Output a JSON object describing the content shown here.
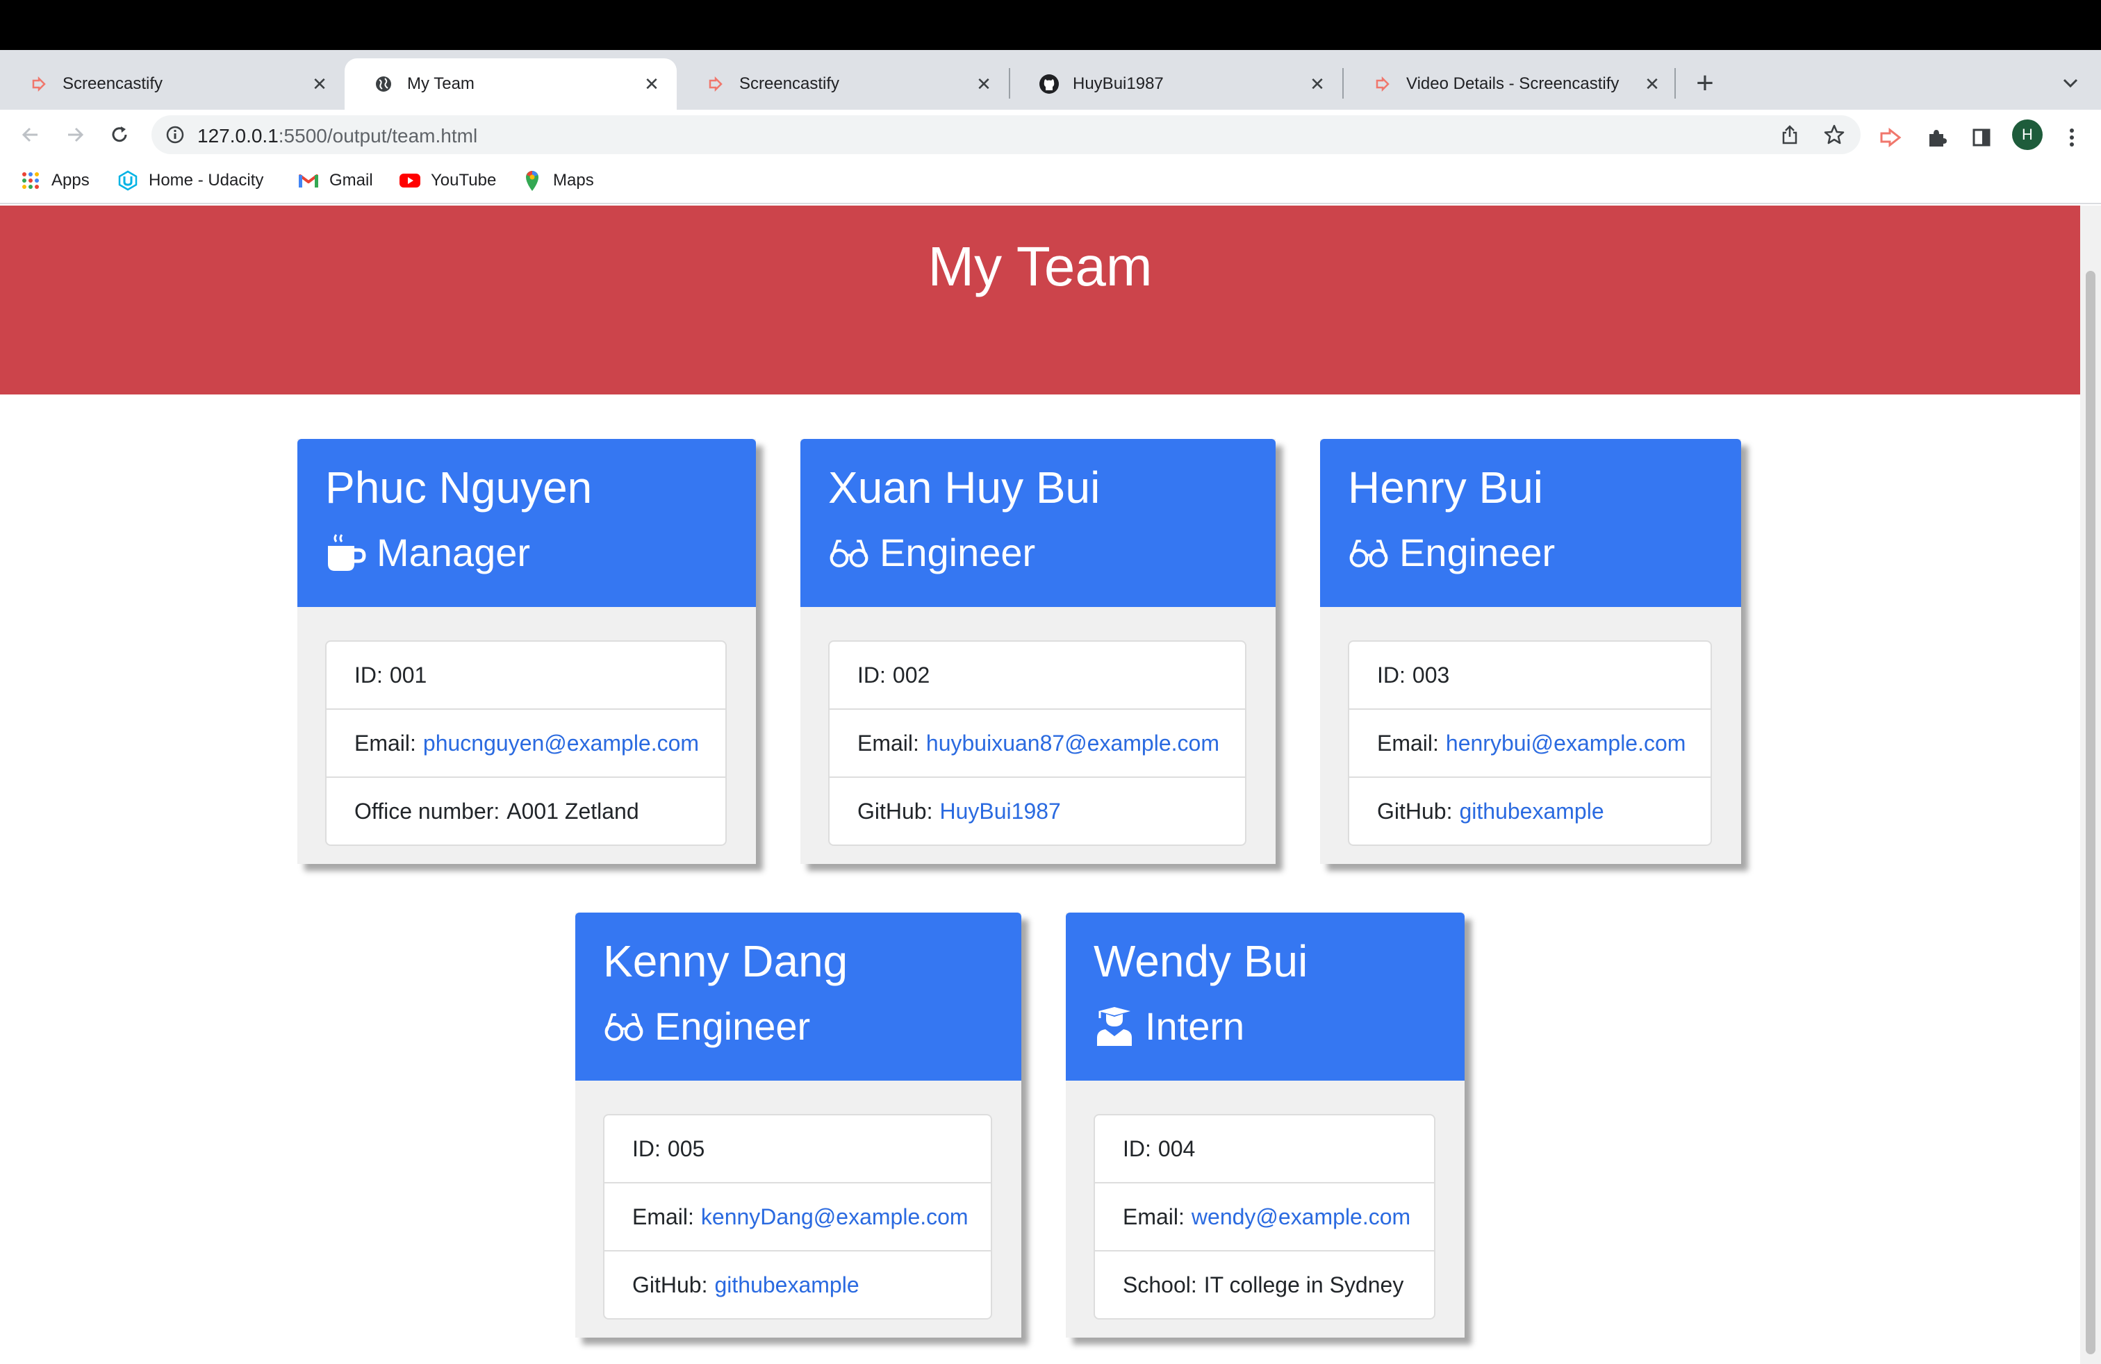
{
  "browser": {
    "tabs": [
      {
        "title": "Screencastify",
        "favicon": "screencastify-icon",
        "active": false
      },
      {
        "title": "My Team",
        "favicon": "globe-icon",
        "active": true
      },
      {
        "title": "Screencastify",
        "favicon": "screencastify-icon",
        "active": false
      },
      {
        "title": "HuyBui1987",
        "favicon": "github-icon",
        "active": false
      },
      {
        "title": "Video Details - Screencastify",
        "favicon": "screencastify-icon",
        "active": false
      }
    ],
    "url_host": "127.0.0.1",
    "url_path": ":5500/output/team.html",
    "profile_initial": "H",
    "bookmarks": [
      {
        "label": "Apps",
        "icon": "apps-grid-icon"
      },
      {
        "label": "Home - Udacity",
        "icon": "udacity-icon"
      },
      {
        "label": "Gmail",
        "icon": "gmail-icon"
      },
      {
        "label": "YouTube",
        "icon": "youtube-icon"
      },
      {
        "label": "Maps",
        "icon": "maps-pin-icon"
      }
    ]
  },
  "page": {
    "title": "My Team",
    "colors": {
      "header": "#cc444b",
      "card_header": "#3577f2",
      "link": "#2a6ae0"
    },
    "cards": [
      {
        "name": "Phuc Nguyen",
        "role": "Manager",
        "role_icon": "coffee-mug-icon",
        "id_label": "ID:",
        "id": "001",
        "email_label": "Email:",
        "email": "phucnguyen@example.com",
        "extra_label": "Office number:",
        "extra": "A001 Zetland"
      },
      {
        "name": "Xuan Huy Bui",
        "role": "Engineer",
        "role_icon": "glasses-icon",
        "id_label": "ID:",
        "id": "002",
        "email_label": "Email:",
        "email": "huybuixuan87@example.com",
        "extra_label": "GitHub:",
        "extra": "HuyBui1987"
      },
      {
        "name": "Henry Bui",
        "role": "Engineer",
        "role_icon": "glasses-icon",
        "id_label": "ID:",
        "id": "003",
        "email_label": "Email:",
        "email": "henrybui@example.com",
        "extra_label": "GitHub:",
        "extra": "githubexample"
      },
      {
        "name": "Kenny Dang",
        "role": "Engineer",
        "role_icon": "glasses-icon",
        "id_label": "ID:",
        "id": "005",
        "email_label": "Email:",
        "email": "kennyDang@example.com",
        "extra_label": "GitHub:",
        "extra": "githubexample"
      },
      {
        "name": "Wendy Bui",
        "role": "Intern",
        "role_icon": "graduate-icon",
        "id_label": "ID:",
        "id": "004",
        "email_label": "Email:",
        "email": "wendy@example.com",
        "extra_label": "School:",
        "extra": "IT college in Sydney"
      }
    ]
  }
}
